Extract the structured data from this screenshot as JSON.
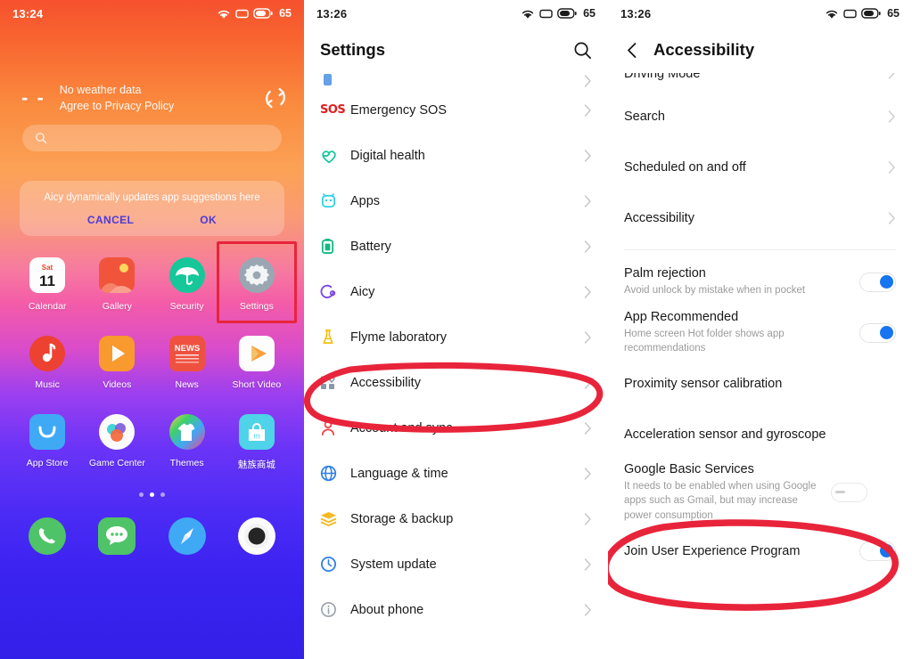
{
  "home": {
    "statusbar": {
      "time": "13:24",
      "battery": "65",
      "wifi_icon": "wifi-icon",
      "signal_icon": "no-sim-icon",
      "battery_icon": "battery-icon"
    },
    "weather": {
      "temp": "- -",
      "line1": "No weather data",
      "line2": "Agree to Privacy Policy",
      "refresh_icon": "refresh-icon"
    },
    "search": {
      "placeholder": "",
      "icon": "search-icon"
    },
    "aicy_card": {
      "text": "Aicy dynamically updates app suggestions here",
      "cancel_label": "CANCEL",
      "ok_label": "OK"
    },
    "apps_row1": [
      {
        "label": "Calendar",
        "icon": "calendar-icon",
        "day_name": "Sat",
        "day_num": "11"
      },
      {
        "label": "Gallery",
        "icon": "gallery-icon"
      },
      {
        "label": "Security",
        "icon": "umbrella-security-icon"
      },
      {
        "label": "Settings",
        "icon": "gear-settings-icon",
        "highlighted": true
      }
    ],
    "apps_row2": [
      {
        "label": "Music",
        "icon": "music-note-icon"
      },
      {
        "label": "Videos",
        "icon": "video-play-icon"
      },
      {
        "label": "News",
        "icon": "news-icon",
        "tile_text": "NEWS"
      },
      {
        "label": "Short Video",
        "icon": "short-video-icon"
      }
    ],
    "apps_row3": [
      {
        "label": "App Store",
        "icon": "app-store-bag-icon"
      },
      {
        "label": "Game Center",
        "icon": "game-center-icon"
      },
      {
        "label": "Themes",
        "icon": "themes-shirt-icon"
      },
      {
        "label": "魅族商城",
        "icon": "meizu-store-icon"
      }
    ],
    "page_dots": {
      "count": 3,
      "active_index": 1
    },
    "dock": [
      {
        "label": "Phone",
        "icon": "phone-icon"
      },
      {
        "label": "Messages",
        "icon": "messages-icon"
      },
      {
        "label": "Browser",
        "icon": "compass-browser-icon"
      },
      {
        "label": "Camera",
        "icon": "camera-icon"
      }
    ]
  },
  "settings": {
    "statusbar": {
      "time": "13:26",
      "battery": "65"
    },
    "title": "Settings",
    "search_icon": "search-icon",
    "cut_top_row": {
      "label": "",
      "icon": "partial-row"
    },
    "items": [
      {
        "label": "Emergency SOS",
        "icon": "sos-icon"
      },
      {
        "label": "Digital health",
        "icon": "digital-health-heart-icon"
      },
      {
        "label": "Apps",
        "icon": "apps-android-icon"
      },
      {
        "label": "Battery",
        "icon": "battery-icon"
      },
      {
        "label": "Aicy",
        "icon": "aicy-icon"
      },
      {
        "label": "Flyme laboratory",
        "icon": "flask-icon"
      },
      {
        "label": "Accessibility",
        "icon": "accessibility-grid-icon",
        "annotated": true
      },
      {
        "label": "Account and sync",
        "icon": "account-person-icon"
      },
      {
        "label": "Language & time",
        "icon": "globe-icon"
      },
      {
        "label": "Storage & backup",
        "icon": "storage-layers-icon"
      },
      {
        "label": "System update",
        "icon": "system-update-icon"
      },
      {
        "label": "About phone",
        "icon": "info-icon"
      }
    ]
  },
  "accessibility": {
    "statusbar": {
      "time": "13:26",
      "battery": "65"
    },
    "title": "Accessibility",
    "back_icon": "back-chevron-icon",
    "cut_top_row": {
      "label": "Driving Mode"
    },
    "nav_items": [
      {
        "label": "Search"
      },
      {
        "label": "Scheduled on and off"
      },
      {
        "label": "Accessibility"
      }
    ],
    "toggle_items": [
      {
        "label": "Palm rejection",
        "sub": "Avoid unlock by mistake when in pocket",
        "state": "on"
      },
      {
        "label": "App Recommended",
        "sub": "Home screen Hot folder shows app recommendations",
        "state": "on"
      }
    ],
    "plain_items": [
      {
        "label": "Proximity sensor calibration"
      },
      {
        "label": "Acceleration sensor and gyroscope"
      }
    ],
    "google_row": {
      "label": "Google Basic Services",
      "sub": "It needs to be enabled when using Google apps such as Gmail, but may increase power consumption",
      "state": "off",
      "annotated": true
    },
    "last_row": {
      "label": "Join User Experience Program",
      "state": "on"
    }
  },
  "annotations": {
    "color": "#e8243b",
    "settings_box": "red-rectangle-around-settings-app-icon",
    "accessibility_ellipse": "red-ellipse-around-accessibility-row",
    "google_ellipse": "red-ellipse-around-google-basic-services-row"
  }
}
